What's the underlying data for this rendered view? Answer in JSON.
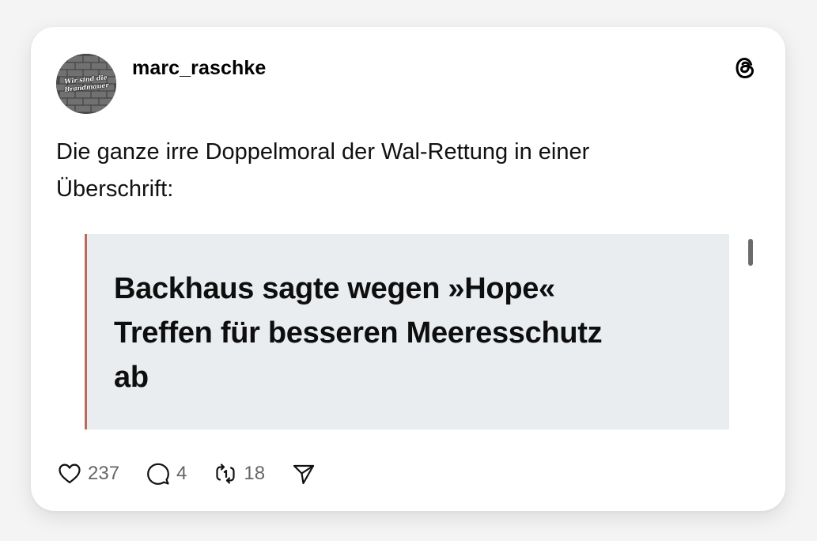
{
  "post": {
    "username": "marc_raschke",
    "avatar_text_line1": "Wir sind die",
    "avatar_text_line2": "Brandmauer",
    "text_line1": "Die ganze irre Doppelmoral der Wal-Rettung in einer",
    "text_line2": "Überschrift:",
    "quote": {
      "headline_line1": "Backhaus sagte wegen »Hope«",
      "headline_line2": "Treffen für besseren Meeresschutz",
      "headline_line3": "ab",
      "background": "#e9edf0",
      "border_color": "#b96a5c"
    }
  },
  "actions": {
    "likes": "237",
    "replies": "4",
    "reposts": "18"
  },
  "icons": {
    "platform": "threads-icon",
    "like": "heart-icon",
    "reply": "speech-bubble-icon",
    "repost": "repost-icon",
    "share": "send-icon"
  },
  "colors": {
    "card_background": "#ffffff",
    "page_background": "#f4f4f4",
    "count_text": "#666666"
  }
}
